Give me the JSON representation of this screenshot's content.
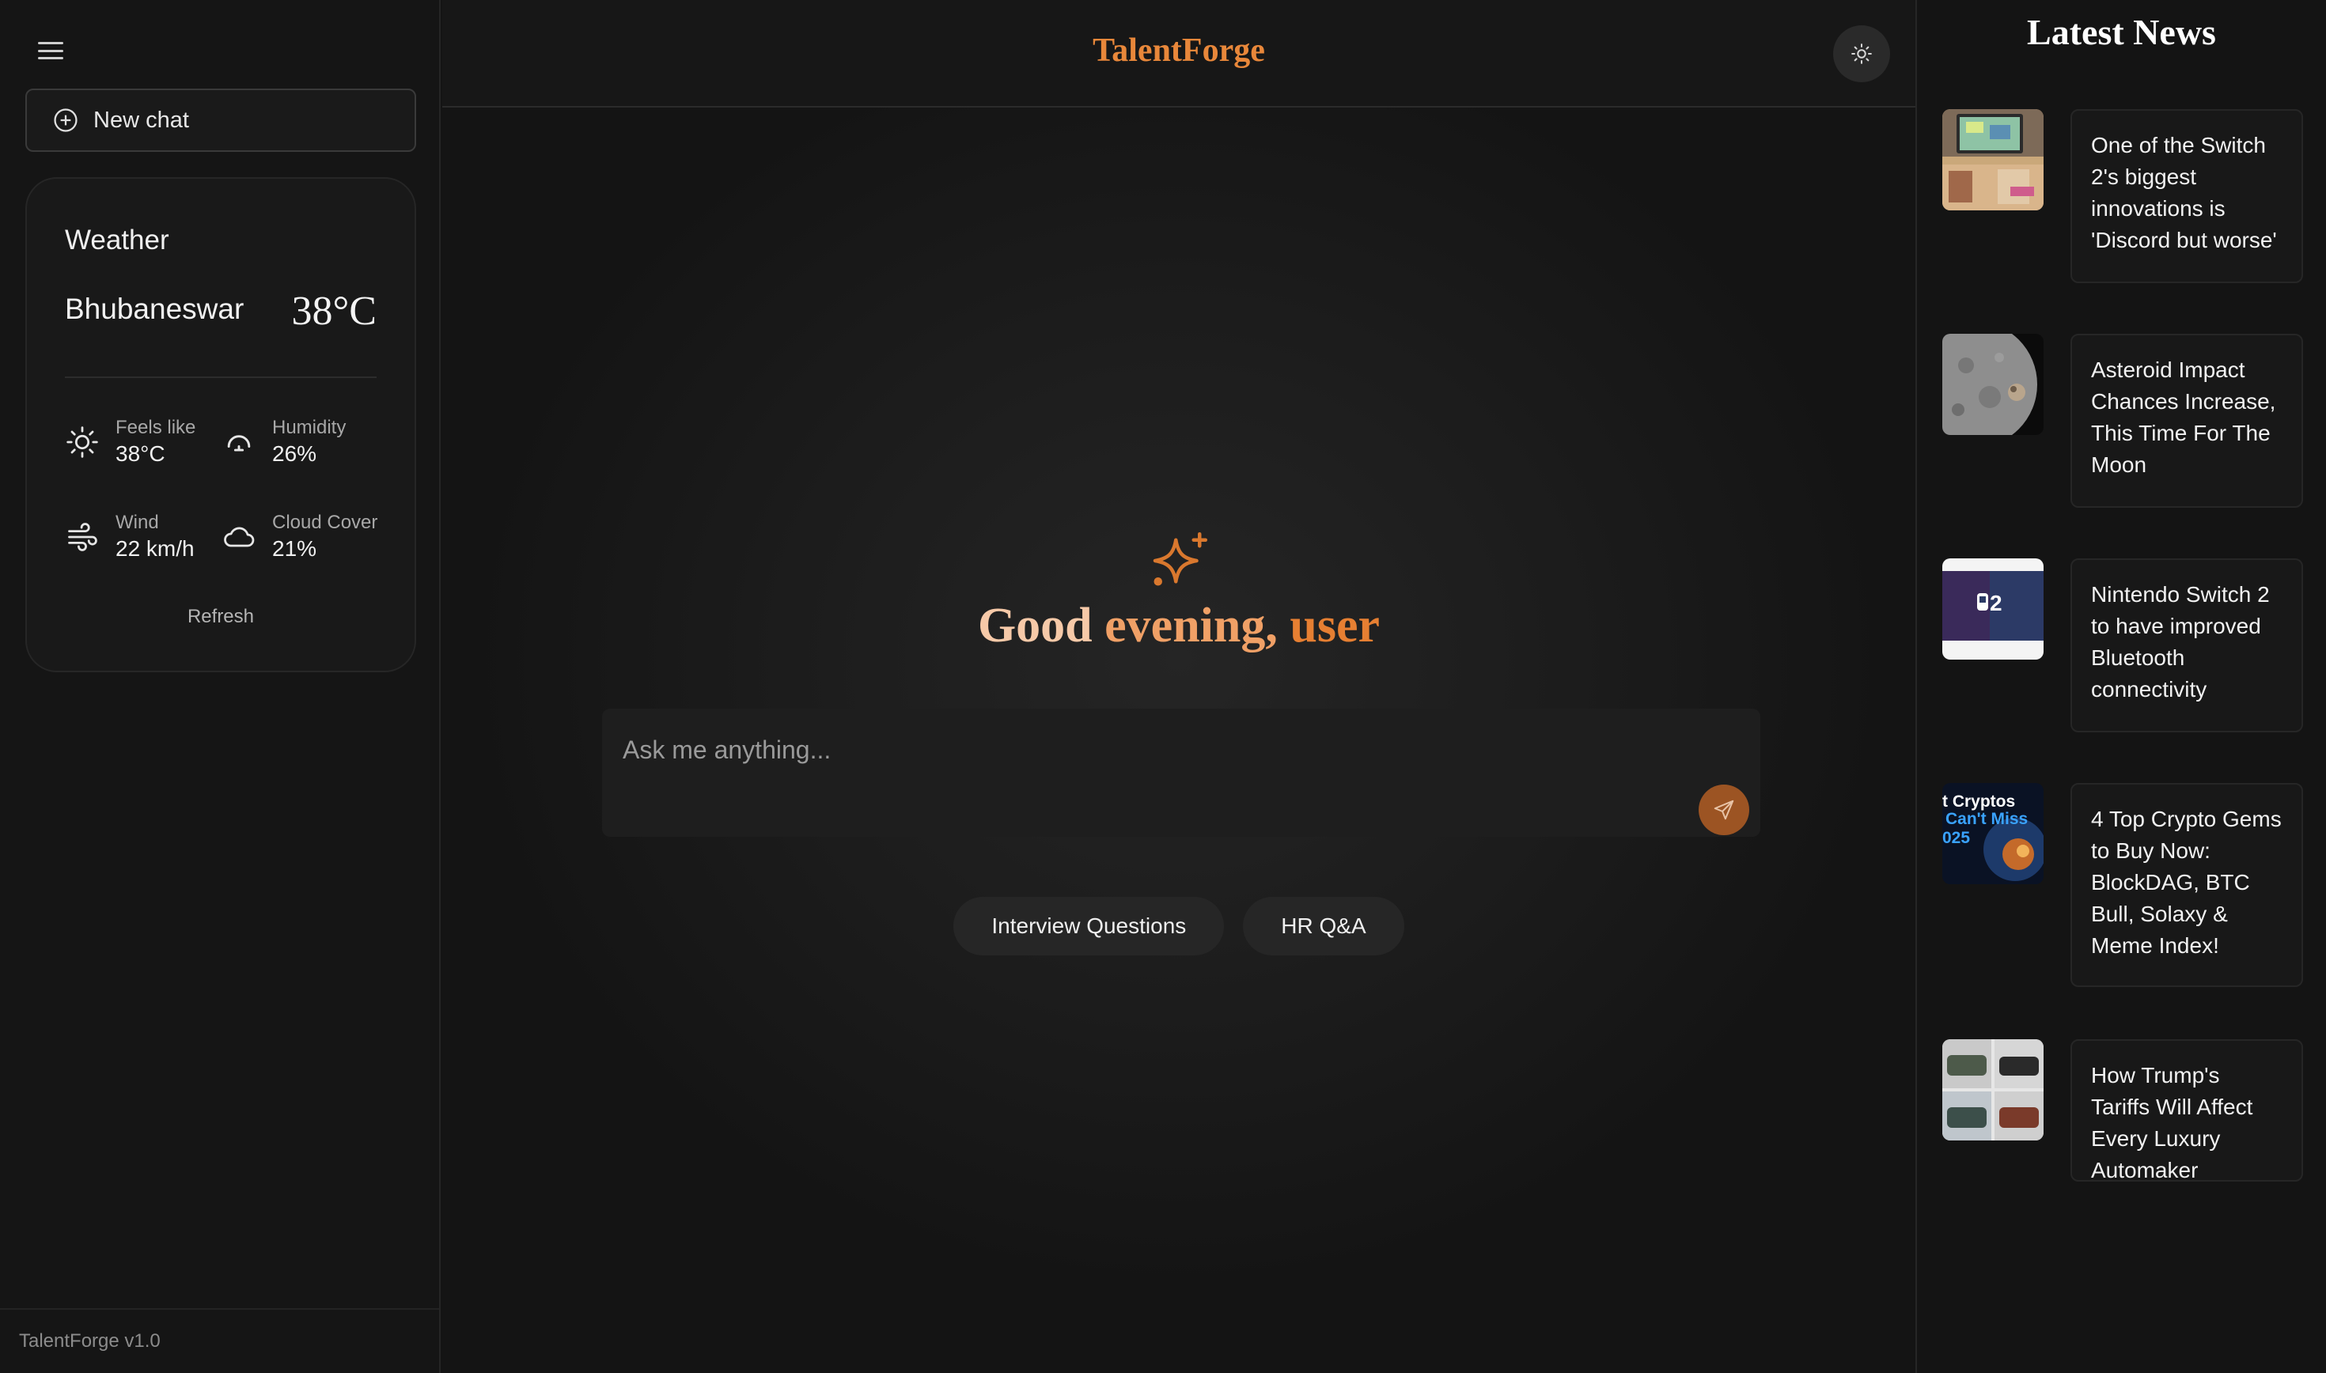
{
  "sidebar": {
    "new_chat_label": "New chat",
    "footer": "TalentForge v1.0",
    "weather": {
      "title": "Weather",
      "city": "Bhubaneswar",
      "temp": "38°C",
      "metrics": [
        {
          "label": "Feels like",
          "value": "38°C",
          "icon": "sun-icon"
        },
        {
          "label": "Humidity",
          "value": "26%",
          "icon": "gauge-icon"
        },
        {
          "label": "Wind",
          "value": "22 km/h",
          "icon": "wind-icon"
        },
        {
          "label": "Cloud Cover",
          "value": "21%",
          "icon": "cloud-icon"
        }
      ],
      "refresh_label": "Refresh"
    }
  },
  "header": {
    "brand": "TalentForge"
  },
  "main": {
    "greeting": {
      "part1": "Good",
      "part2": "evening,",
      "part3": "user"
    },
    "input_placeholder": "Ask me anything...",
    "chips": [
      "Interview Questions",
      "HR Q&A"
    ]
  },
  "news": {
    "title": "Latest News",
    "items": [
      {
        "headline": "One of the Switch 2's biggest innovations is 'Discord but worse'"
      },
      {
        "headline": "Asteroid Impact Chances Increase, This Time For The Moon"
      },
      {
        "headline": "Nintendo Switch 2 to have improved Bluetooth connectivity"
      },
      {
        "headline": "4 Top Crypto Gems to Buy Now: BlockDAG, BTC Bull, Solaxy & Meme Index!"
      },
      {
        "headline": "How Trump's Tariffs Will Affect Every Luxury Automaker"
      }
    ],
    "thumb_texts": {
      "switch_logo": "2",
      "crypto_line1": "t Cryptos",
      "crypto_line2": "Can't Miss",
      "crypto_line3": "025"
    }
  },
  "colors": {
    "accent": "#e8873a",
    "send": "#9c5423"
  }
}
